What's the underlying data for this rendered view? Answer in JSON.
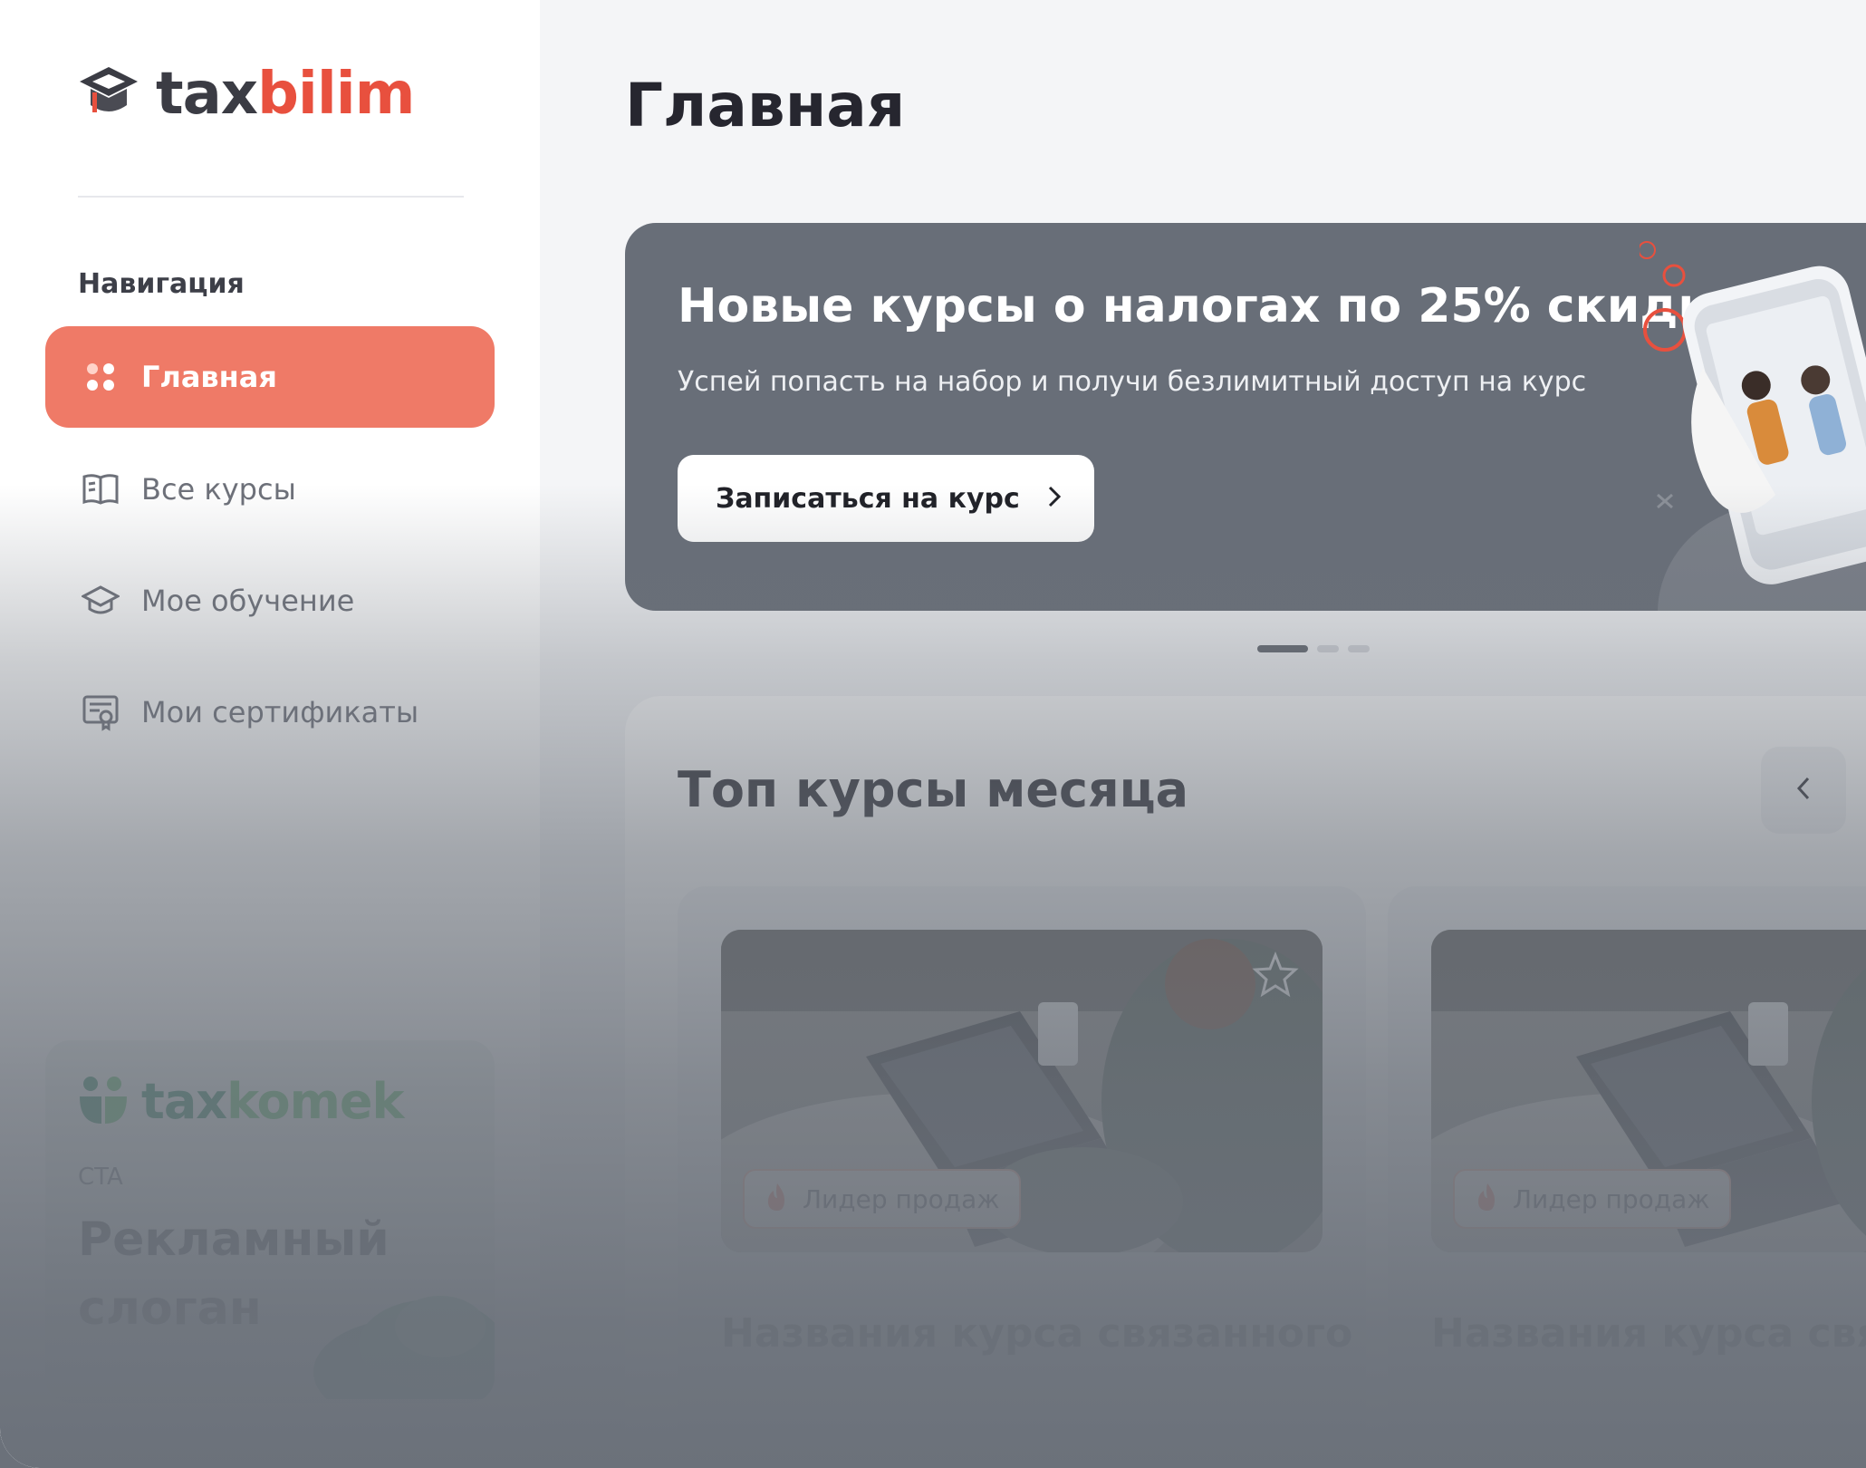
{
  "sidebar": {
    "logo": {
      "text_main": "tax",
      "text_accent": "bilim"
    },
    "nav_title": "Навигация",
    "items": [
      {
        "label": "Главная",
        "active": true,
        "icon": "grid-dots-icon"
      },
      {
        "label": "Все курсы",
        "active": false,
        "icon": "book-icon"
      },
      {
        "label": "Мое обучение",
        "active": false,
        "icon": "graduation-cap-icon"
      },
      {
        "label": "Мои сертификаты",
        "active": false,
        "icon": "certificate-icon"
      }
    ],
    "promo": {
      "logo_main": "tax",
      "logo_accent": "komek",
      "cta": "CTA",
      "slogan": "Рекламный слоган"
    }
  },
  "main": {
    "page_title": "Главная",
    "banner": {
      "title": "Новые курсы о налогах по 25% скидке",
      "subtitle": "Успей попасть на набор и получи безлимитный доступ на курс",
      "button_label": "Записаться на курс"
    },
    "carousel": {
      "count": 3,
      "active_index": 0
    },
    "top_courses": {
      "title": "Топ курсы месяца",
      "courses": [
        {
          "badge": "Лидер продаж",
          "title": "Названия курса связанного с налогами и прочее",
          "favorite": false
        },
        {
          "badge": "Лидер продаж",
          "title": "Названия курса связанного с налогами и прочее",
          "favorite": false
        }
      ]
    }
  },
  "colors": {
    "accent": "#ef7a67",
    "brand_red": "#e8503e",
    "banner_bg": "#686e78",
    "fade": "#6b717a",
    "komek_green": "#2f8a63"
  }
}
